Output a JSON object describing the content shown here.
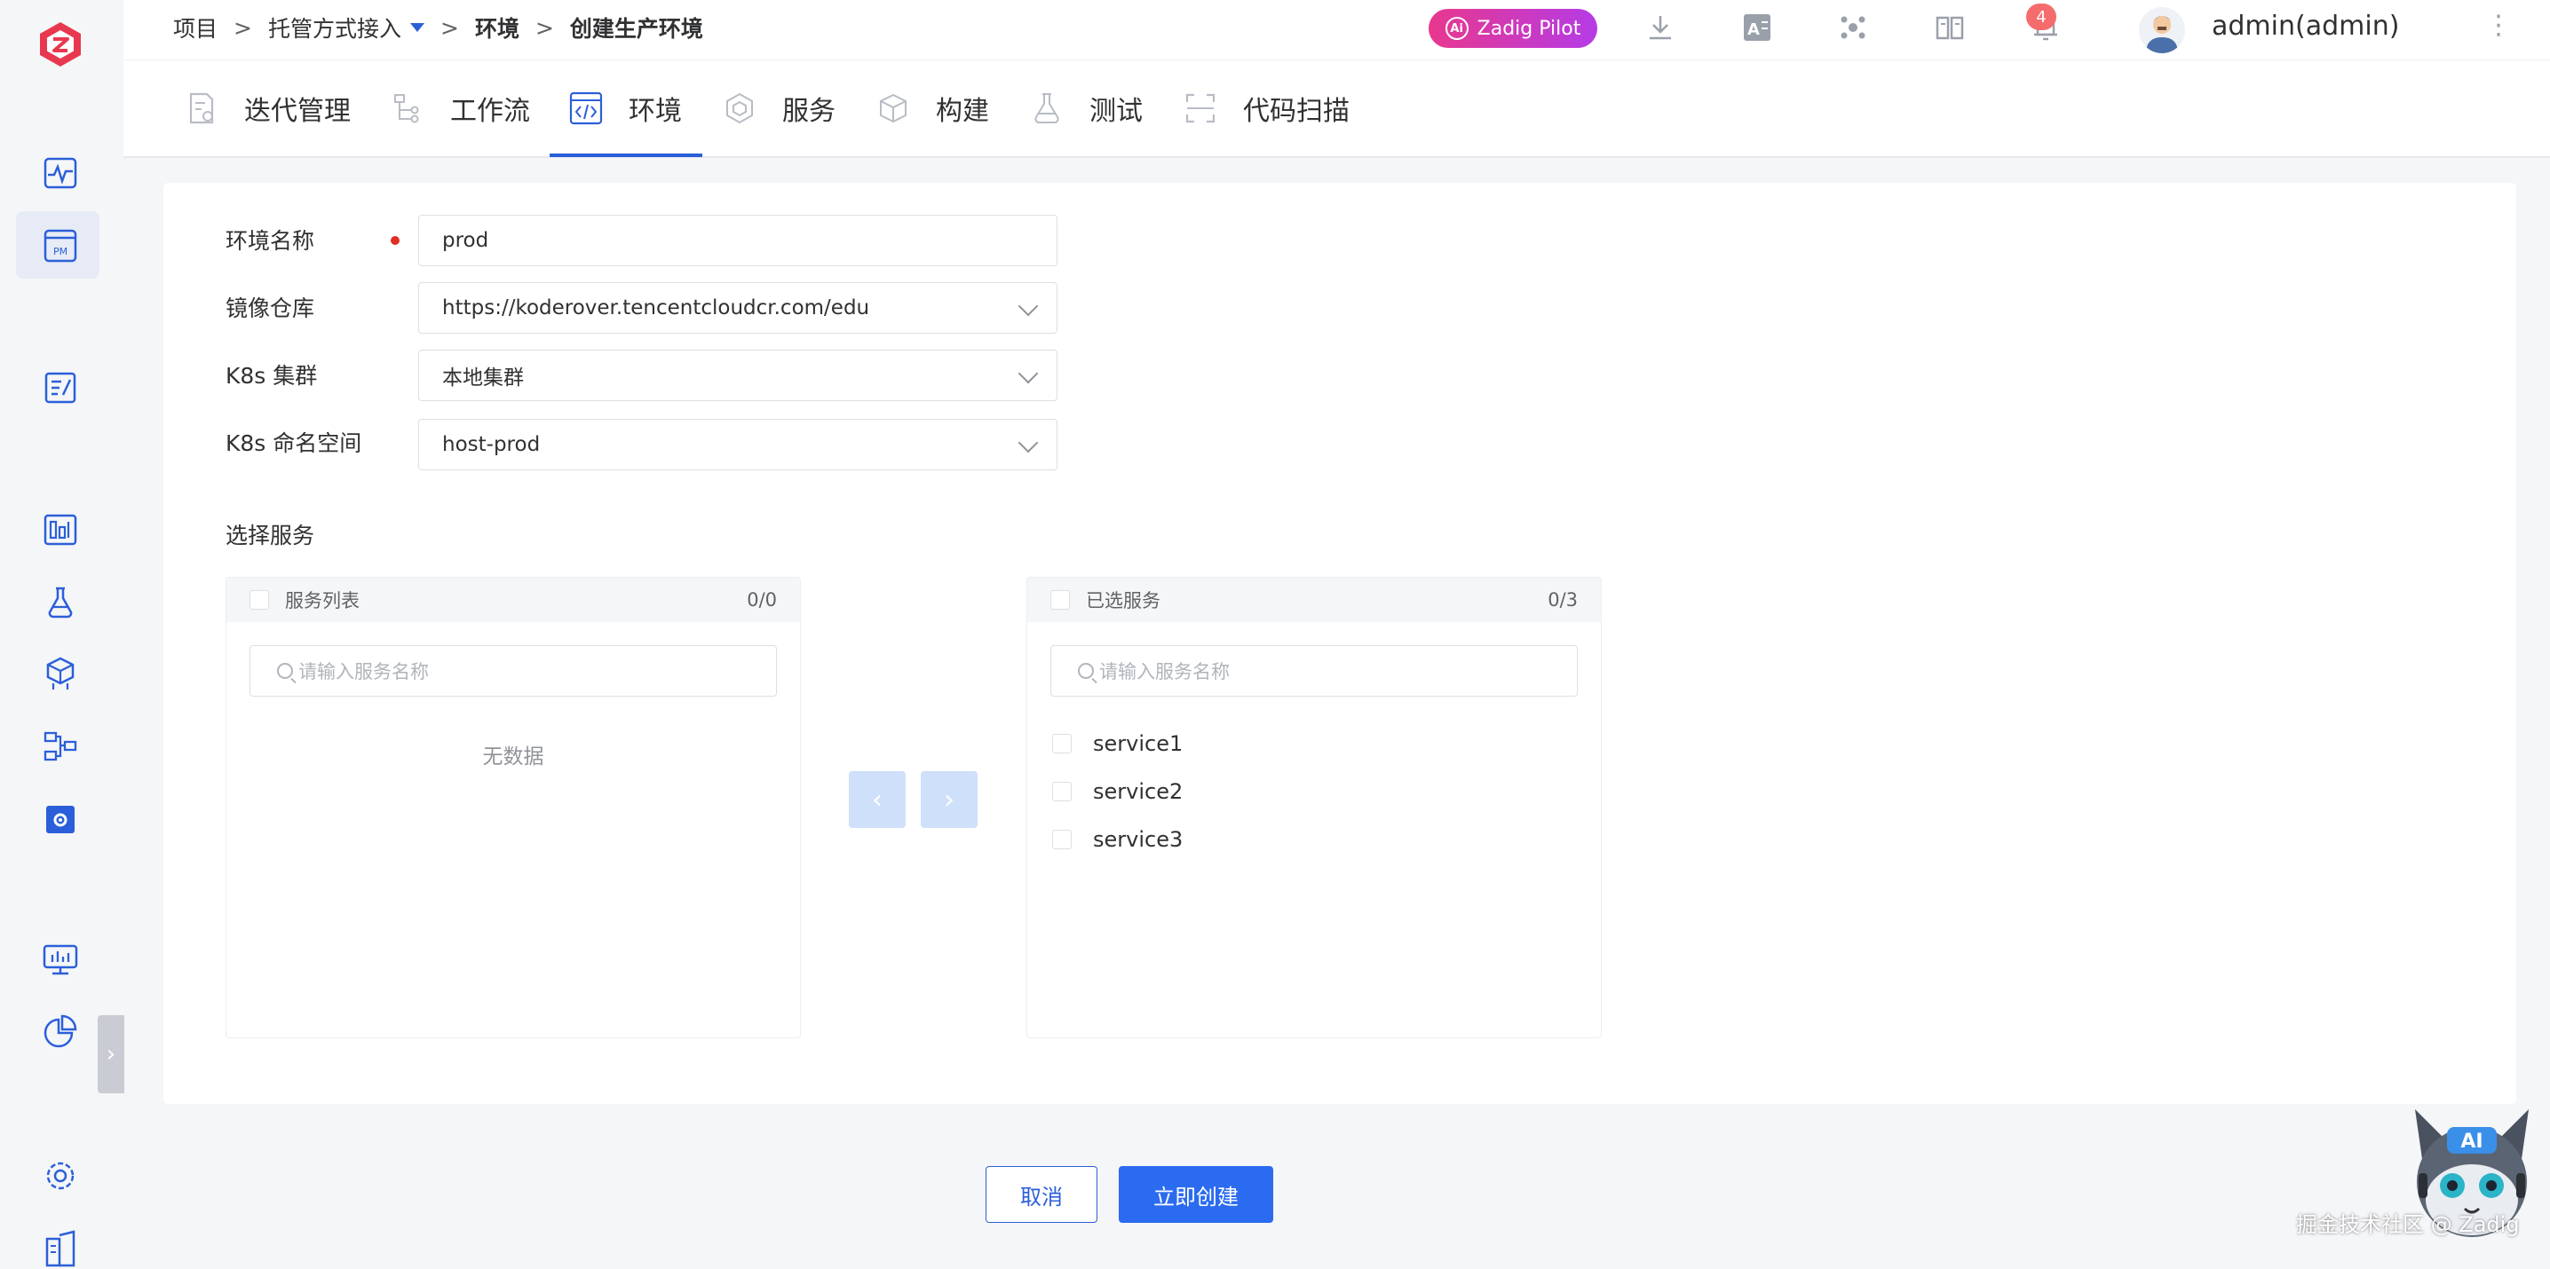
{
  "breadcrumb": {
    "items": [
      "项目",
      "托管方式接入",
      "环境",
      "创建生产环境"
    ],
    "separator": ">"
  },
  "header": {
    "pilot_label": "Zadig Pilot",
    "pilot_ai": "Ai",
    "notification_count": "4",
    "user": "admin(admin)",
    "icons": [
      "download-icon",
      "translate-icon",
      "hub-icon",
      "docs-icon",
      "bell-icon",
      "more-vertical-icon"
    ]
  },
  "tabs": [
    {
      "label": "迭代管理",
      "icon": "iteration-icon"
    },
    {
      "label": "工作流",
      "icon": "workflow-icon"
    },
    {
      "label": "环境",
      "icon": "code-icon",
      "active": true
    },
    {
      "label": "服务",
      "icon": "service-icon"
    },
    {
      "label": "构建",
      "icon": "build-icon"
    },
    {
      "label": "测试",
      "icon": "flask-icon"
    },
    {
      "label": "代码扫描",
      "icon": "scan-icon"
    }
  ],
  "form": {
    "env_name": {
      "label": "环境名称",
      "value": "prod"
    },
    "registry": {
      "label": "镜像仓库",
      "value": "https://koderover.tencentcloudcr.com/edu"
    },
    "cluster": {
      "label": "K8s 集群",
      "value": "本地集群"
    },
    "namespace": {
      "label": "K8s 命名空间",
      "value": "host-prod"
    }
  },
  "services": {
    "section_title": "选择服务",
    "left": {
      "title": "服务列表",
      "count": "0/0",
      "placeholder": "请输入服务名称",
      "empty": "无数据"
    },
    "right": {
      "title": "已选服务",
      "count": "0/3",
      "placeholder": "请输入服务名称",
      "items": [
        "service1",
        "service2",
        "service3"
      ]
    },
    "move_left": "‹",
    "move_right": "›"
  },
  "actions": {
    "cancel": "取消",
    "create": "立即创建"
  },
  "watermark": "掘金技术社区 @ Zadig",
  "colors": {
    "primary": "#2b5fd9",
    "button": "#2b6bf0",
    "required": "#e02e24",
    "badge": "#f56c6c"
  }
}
